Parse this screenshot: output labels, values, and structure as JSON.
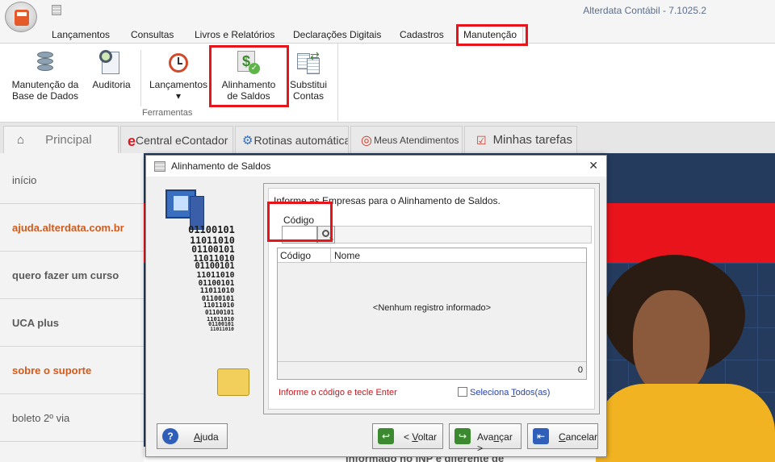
{
  "app": {
    "title": "Alterdata Contábil - 7.1025.2"
  },
  "ribbon": {
    "tabs": [
      "Lançamentos",
      "Consultas",
      "Livros e Relatórios",
      "Declarações Digitais",
      "Cadastros",
      "Manutenção"
    ],
    "active_tab": "Manutenção",
    "buttons": [
      {
        "line1": "Manutenção da",
        "line2": "Base de Dados",
        "icon": "database-icon"
      },
      {
        "line1": "Auditoria",
        "line2": "",
        "icon": "audit-search-icon"
      },
      {
        "line1": "Lançamentos",
        "line2": "▾",
        "icon": "clock-icon"
      },
      {
        "line1": "Alinhamento",
        "line2": "de Saldos",
        "icon": "money-document-icon"
      },
      {
        "line1": "Substitui",
        "line2": "Contas",
        "icon": "swap-documents-icon"
      }
    ],
    "group_label": "Ferramentas"
  },
  "main_tabs": [
    {
      "label": "Principal",
      "icon": "home-icon"
    },
    {
      "label": "Central eContador",
      "icon": "econtador-icon"
    },
    {
      "label": "Rotinas automáticas",
      "icon": "gear-clock-icon"
    },
    {
      "label": "Meus Atendimentos",
      "icon": "support-icon"
    },
    {
      "label": "Minhas tarefas",
      "icon": "checkbox-icon"
    }
  ],
  "left_nav": [
    {
      "label": "início"
    },
    {
      "label": "ajuda.alterdata.com.br"
    },
    {
      "label": "quero fazer um curso"
    },
    {
      "label": "UCA plus"
    },
    {
      "label": "sobre o suporte"
    },
    {
      "label": "boleto 2º via"
    }
  ],
  "dialog": {
    "title": "Alinhamento de Saldos",
    "instruction": "Informe as Empresas para o Alinhamento de Saldos.",
    "codigo_label": "Código",
    "codigo_value": "",
    "grid_headers": [
      "Código",
      "Nome"
    ],
    "grid_empty": "<Nenhum registro informado>",
    "grid_count": "0",
    "hint": "Informe o código e tecle Enter",
    "select_all_prefix": "Seleciona ",
    "select_all_accel": "T",
    "select_all_suffix": "odos(as)",
    "binary_lines": [
      "01100101",
      "11011010",
      "01100101",
      "11011010",
      "01100101",
      "11011010",
      "01100101",
      "11011010",
      "01100101",
      "11011010",
      "01100101",
      "11011010",
      "01100101",
      "11011010"
    ],
    "buttons": {
      "help": {
        "accel": "A",
        "rest": "juda"
      },
      "back": {
        "prefix": "< ",
        "accel": "V",
        "rest": "oltar"
      },
      "next": {
        "prefix": "Ava",
        "accel": "n",
        "rest": "çar >"
      },
      "cancel": {
        "accel": "C",
        "rest": "ancelar"
      }
    }
  },
  "banner": {
    "bottom_text": "informado no INP e diferente de"
  },
  "colors": {
    "highlight": "#e8131b",
    "nav_orange": "#d45a1a",
    "hint_red": "#c8161d",
    "link_blue": "#2643a6"
  }
}
